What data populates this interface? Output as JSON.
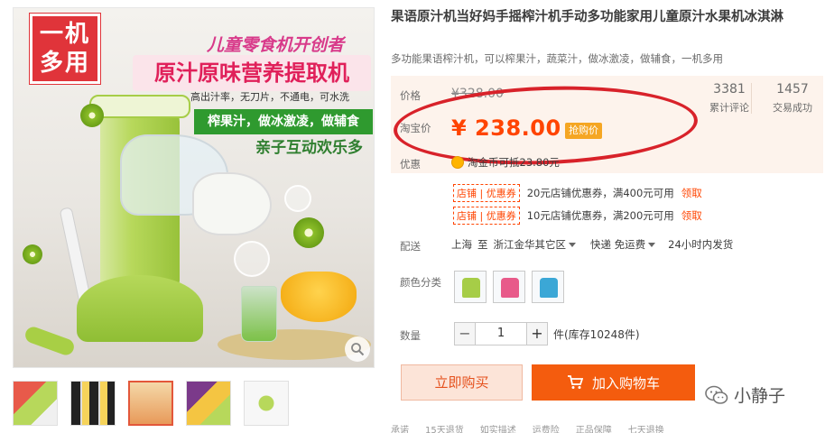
{
  "image": {
    "badge_line1": "一机",
    "badge_line2": "多用",
    "slogan_top": "儿童零食机开创者",
    "slogan_main": "原汁原味营养提取机",
    "features": "高出汁率，无刀片，不通电，可水洗",
    "green_band": "榨果汁，做冰激凌，做辅食",
    "slogan_family": "亲子互动欢乐多",
    "zoom_icon": "magnifier-icon"
  },
  "thumbnails": [
    {
      "name": "thumb-1"
    },
    {
      "name": "thumb-2"
    },
    {
      "name": "thumb-3",
      "active": true
    },
    {
      "name": "thumb-4"
    },
    {
      "name": "thumb-5"
    }
  ],
  "product": {
    "title": "果语原汁机当好妈手摇榨汁机手动多功能家用儿童原汁水果机冰淇淋",
    "subtitle": "多功能果语榨汁机，可以榨果汁，蔬菜汁，做冰激凌，做辅食，一机多用"
  },
  "price": {
    "price_label": "价格",
    "old_price": "¥328.00",
    "taobao_label": "淘宝价",
    "new_price": "¥ 238.00",
    "rush_tag": "抢购价",
    "reviews_count": "3381",
    "reviews_label": "累计评论",
    "deals_count": "1457",
    "deals_label": "交易成功",
    "promo_label": "优惠",
    "coin_text": "淘金币可抵23.80元"
  },
  "coupons": [
    {
      "tag": "店铺 | 优惠券",
      "text": "20元店铺优惠券，满400元可用",
      "link": "领取"
    },
    {
      "tag": "店铺 | 优惠券",
      "text": "10元店铺优惠券，满200元可用",
      "link": "领取"
    }
  ],
  "shipping": {
    "label": "配送",
    "from": "上海",
    "to_word": "至",
    "to": "浙江金华其它区",
    "method": "快递 免运费",
    "time": "24小时内发货"
  },
  "colors": {
    "label": "颜色分类",
    "options": [
      "#a6cd47",
      "#e85a8a",
      "#3ba7d6"
    ]
  },
  "quantity": {
    "label": "数量",
    "minus": "−",
    "value": "1",
    "plus": "+",
    "stock": "件(库存10248件)"
  },
  "actions": {
    "buy_now": "立即购买",
    "add_cart": "加入购物车"
  },
  "watermark": "小静子",
  "footer": {
    "label": "承诺",
    "items": [
      "15天退货",
      "如实描述",
      "运费险",
      "正品保障",
      "七天退换"
    ]
  },
  "accent": "#ff4400"
}
